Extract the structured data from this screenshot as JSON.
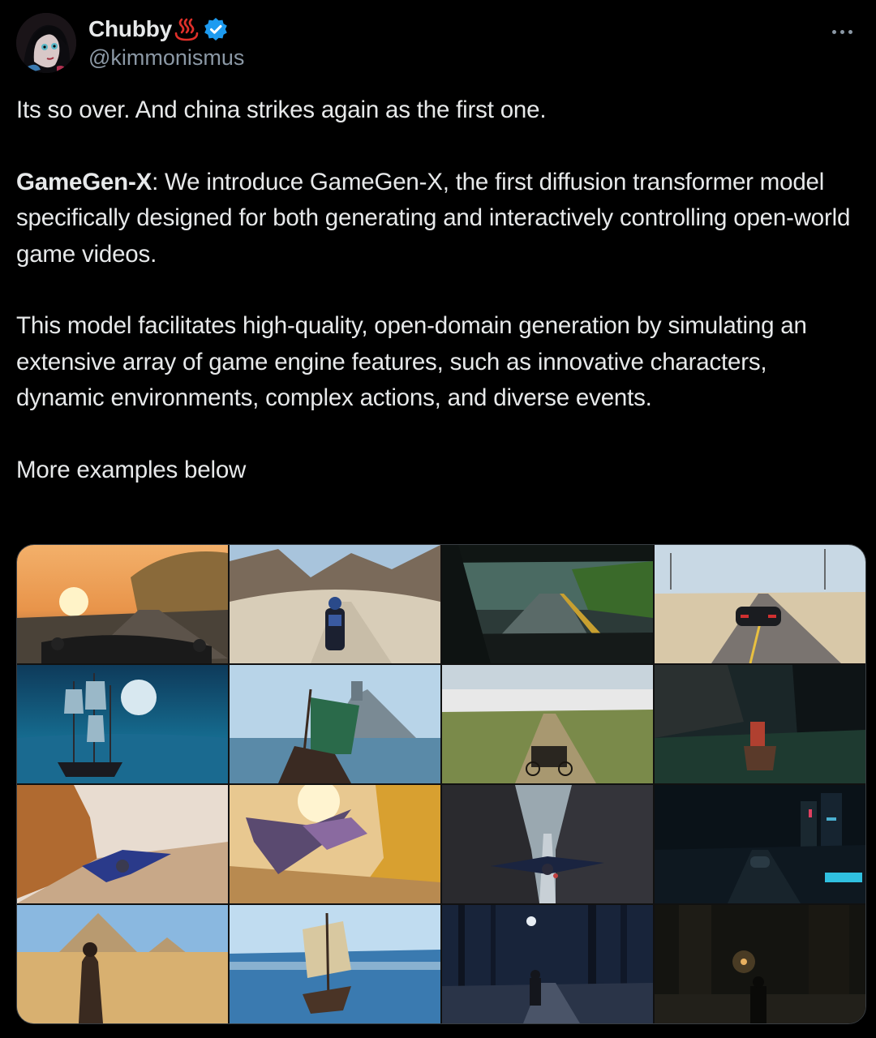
{
  "author": {
    "display_name": "Chubby",
    "handle": "@kimmonismus",
    "name_emoji": "hot-springs-emoji",
    "verified": true,
    "verified_color": "#1d9bf0"
  },
  "menu": {
    "icon": "more-horizontal-icon"
  },
  "post": {
    "line1": "Its so over. And china strikes again as the first one.",
    "para2_bold": "GameGen-X",
    "para2_rest": ": We introduce GameGen-X, the first diffusion transformer model specifically designed for both generating and interactively controlling open-world game videos.",
    "para3": "This model facilitates high-quality, open-domain generation by simulating an extensive array of game engine features, such as innovative characters, dynamic environments, complex actions, and diverse events.",
    "para4": "More examples below"
  },
  "media": {
    "frames": [
      "motorcycle-sunset-coast-road",
      "motorcycle-desert-mountain",
      "car-cockpit-rainy-city",
      "sports-car-desert-highway",
      "pirate-ship-moonlit-sea",
      "viking-ship-green-sail-castle",
      "horse-cart-grassland",
      "rider-horse-dark-forest",
      "flying-creature-canyon-sunset",
      "dragon-flying-golden-cliffs",
      "dragon-flying-canyon",
      "vehicle-night-neon-city",
      "assassin-desert-pyramids",
      "sailing-ship-ocean",
      "man-walking-night-forest",
      "figure-dark-gothic-street"
    ]
  },
  "colors": {
    "background": "#000000",
    "text": "#e7e9ea",
    "secondary_text": "#8b98a5",
    "verified_blue": "#1d9bf0",
    "emoji_red": "#e0302a"
  }
}
